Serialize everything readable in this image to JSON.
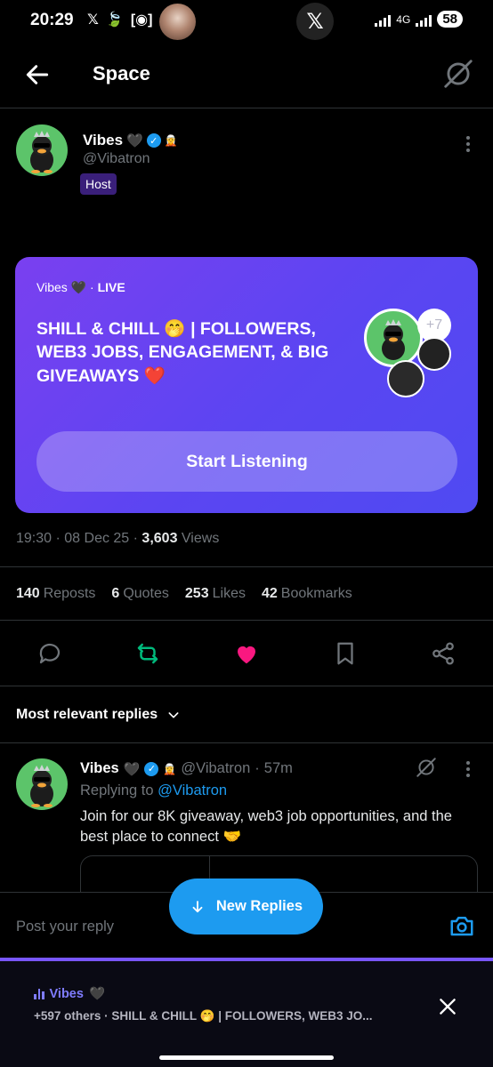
{
  "status_bar": {
    "time": "20:29",
    "battery": "58",
    "network": "4G"
  },
  "header": {
    "title": "Space"
  },
  "host": {
    "name": "Vibes",
    "handle": "@Vibatron",
    "badge": "Host"
  },
  "space_card": {
    "host_name": "Vibes",
    "live_label": "LIVE",
    "title": "SHILL & CHILL 🤭 | FOLLOWERS, WEB3 JOBS, ENGAGEMENT, & BIG GIVEAWAYS ❤️",
    "extra_count": "+7",
    "start_button": "Start Listening",
    "bg_start": "#7a40f0",
    "bg_end": "#4f4af2"
  },
  "meta": {
    "time": "19:30",
    "date": "08 Dec 25",
    "views_count": "3,603",
    "views_label": "Views"
  },
  "stats": [
    {
      "count": "140",
      "label": "Reposts"
    },
    {
      "count": "6",
      "label": "Quotes"
    },
    {
      "count": "253",
      "label": "Likes"
    },
    {
      "count": "42",
      "label": "Bookmarks"
    }
  ],
  "actions": {
    "reply_icon": "comment-icon",
    "repost_icon": "repost-icon",
    "like_icon": "heart-icon",
    "bookmark_icon": "bookmark-icon",
    "share_icon": "share-icon",
    "repost_color": "#00ba7c",
    "like_color": "#f91880"
  },
  "replies_filter": {
    "label": "Most relevant replies"
  },
  "reply": {
    "name": "Vibes",
    "handle": "@Vibatron",
    "time": "57m",
    "replying_prefix": "Replying to",
    "replying_to": "@Vibatron",
    "text": "Join for our 8K giveaway, web3 job opportunities, and the best place to connect 🤝"
  },
  "new_replies": {
    "label": "New Replies"
  },
  "composer": {
    "placeholder": "Post your reply"
  },
  "mini_player": {
    "host": "Vibes",
    "info": "+597 others · SHILL & CHILL 🤭 | FOLLOWERS, WEB3 JO..."
  },
  "colors": {
    "accent_blue": "#1d9bf0",
    "host_badge_bg": "#3a1f7a",
    "mini_player_accent": "#7856ff"
  }
}
